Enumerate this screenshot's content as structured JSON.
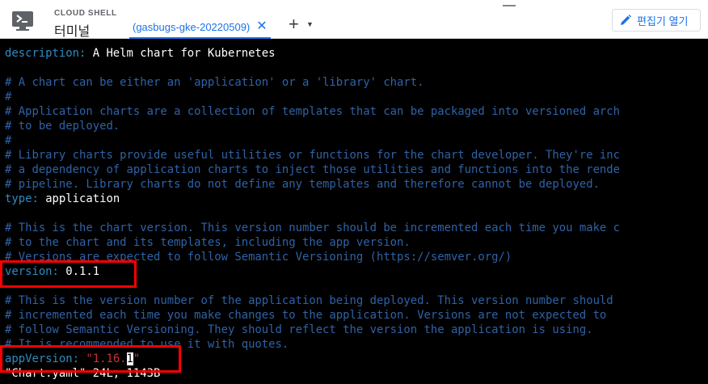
{
  "header": {
    "brand_sub": "CLOUD SHELL",
    "brand_title": "터미널",
    "tab_label": "(gasbugs-gke-20220509)",
    "close_glyph": "✕",
    "add_glyph": "+",
    "dropdown_glyph": "▼",
    "editor_button": "편집기 열기"
  },
  "terminal": {
    "l0": {
      "key": "description:",
      "value": " A Helm chart for Kubernetes"
    },
    "l2": "# A chart can be either an 'application' or a 'library' chart.",
    "l3": "#",
    "l4": "# Application charts are a collection of templates that can be packaged into versioned arch",
    "l5": "# to be deployed.",
    "l6": "#",
    "l7": "# Library charts provide useful utilities or functions for the chart developer. They're inc",
    "l8": "# a dependency of application charts to inject those utilities and functions into the rende",
    "l9": "# pipeline. Library charts do not define any templates and therefore cannot be deployed.",
    "l10": {
      "key": "type:",
      "value": " application"
    },
    "l12": "# This is the chart version. This version number should be incremented each time you make c",
    "l13": "# to the chart and its templates, including the app version.",
    "l14": "# Versions are expected to follow Semantic Versioning (https://semver.org/)",
    "l15": {
      "key": "version:",
      "value": " 0.1.1"
    },
    "l17": "# This is the version number of the application being deployed. This version number should",
    "l18": "# incremented each time you make changes to the application. Versions are not expected to",
    "l19": "# follow Semantic Versioning. They should reflect the version the application is using.",
    "l20": "# It is recommended to use it with quotes.",
    "l21": {
      "key": "appVersion:",
      "pre": " \"1.16.",
      "cursor": "1",
      "post": "\""
    },
    "l22": "\"Chart.yaml\" 24L, 1143B"
  },
  "colors": {
    "comment": "#2f62a6",
    "key": "#2e8bc0",
    "string": "#c7333a",
    "highlight": "#ff0000",
    "accent": "#1a73e8"
  }
}
